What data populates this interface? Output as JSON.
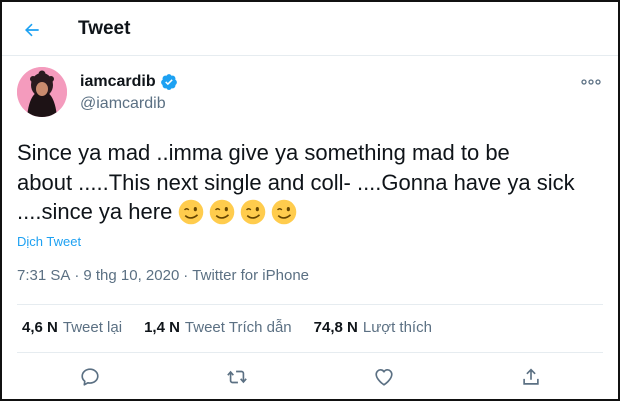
{
  "header": {
    "title": "Tweet",
    "back_icon": "arrow-left-icon"
  },
  "author": {
    "display_name": "iamcardib",
    "handle": "@iamcardib",
    "verified": true,
    "verified_icon": "verified-badge-icon"
  },
  "tweet": {
    "text_line1": "Since ya mad ..imma give ya something mad to be",
    "text_line2": "about .....This next single and coll- ....Gonna have ya sick",
    "text_line3": "....since ya here",
    "emojis": [
      "winking-face-icon",
      "winking-face-icon",
      "winking-face-icon",
      "winking-face-icon"
    ],
    "translate_label": "Dịch Tweet",
    "time": "7:31 SA",
    "date": "9 thg 10, 2020",
    "separator": "·",
    "source": "Twitter for iPhone"
  },
  "stats": [
    {
      "count": "4,6 N",
      "label": "Tweet lại"
    },
    {
      "count": "1,4 N",
      "label": "Tweet Trích dẫn"
    },
    {
      "count": "74,8 N",
      "label": "Lượt thích"
    }
  ],
  "actions": [
    "reply-icon",
    "retweet-icon",
    "like-icon",
    "share-icon"
  ],
  "colors": {
    "accent": "#1da1f2",
    "text": "#0f1419",
    "muted": "#5b7083",
    "border": "#e6ecf0"
  }
}
